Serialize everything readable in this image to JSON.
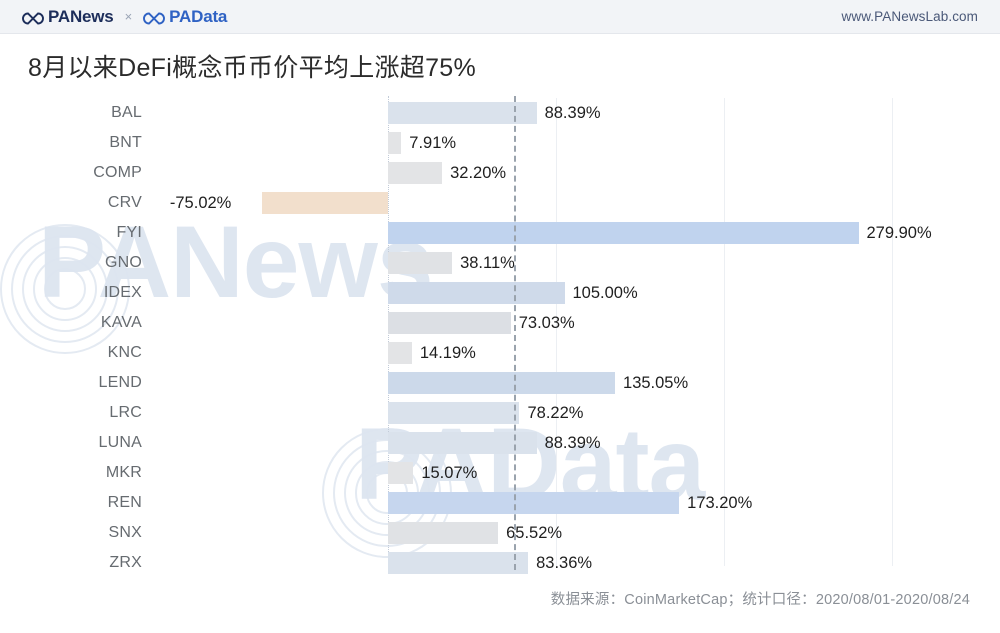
{
  "header": {
    "brand_primary": "PANews",
    "brand_separator": "×",
    "brand_secondary": "PAData",
    "site_url": "www.PANewsLab.com",
    "logo_icon": "infinity-icon"
  },
  "title": "8月以来DeFi概念币币价平均上涨超75%",
  "footer": {
    "source_note": "数据来源：CoinMarketCap；统计口径：2020/08/01-2020/08/24"
  },
  "watermark": {
    "text_1": "PANews",
    "text_2": "PAData"
  },
  "colors": {
    "negative_bar": "#f2dfcc",
    "bar_gray": "#e3e4e6",
    "bar_light_blue": "#dae2ec",
    "bar_mid_blue": "#ccd9ea",
    "bar_strong_blue": "#c0d3ee",
    "average_line": "#9aa3ad",
    "zero_line": "#c2cbd8",
    "grid": "#eceff3",
    "label_text": "#666b70",
    "value_text": "#1f1f1f",
    "header_bg": "#f2f4f7",
    "brand_navy": "#1c2d5a",
    "brand_blue": "#2f62c4"
  },
  "chart_data": {
    "type": "bar",
    "orientation": "horizontal",
    "title": "8月以来DeFi概念币币价平均上涨超75%",
    "xlabel": "",
    "ylabel": "",
    "grid": true,
    "legend": "none",
    "xlim": [
      -100,
      360
    ],
    "average_reference": 75,
    "value_suffix": "%",
    "categories": [
      "BAL",
      "BNT",
      "COMP",
      "CRV",
      "FYI",
      "GNO",
      "IDEX",
      "KAVA",
      "KNC",
      "LEND",
      "LRC",
      "LUNA",
      "MKR",
      "REN",
      "SNX",
      "ZRX"
    ],
    "values": [
      88.39,
      7.91,
      32.2,
      -75.02,
      279.9,
      38.11,
      105.0,
      73.03,
      14.19,
      135.05,
      78.22,
      88.39,
      15.07,
      173.2,
      65.52,
      83.36
    ],
    "labels": [
      "88.39%",
      "7.91%",
      "32.20%",
      "-75.02%",
      "279.90%",
      "38.11%",
      "105.00%",
      "73.03%",
      "14.19%",
      "135.05%",
      "78.22%",
      "88.39%",
      "15.07%",
      "173.20%",
      "65.52%",
      "83.36%"
    ],
    "bar_colors": [
      "#dae2ec",
      "#e3e4e6",
      "#e3e4e6",
      "#f2dfcc",
      "#c0d3ee",
      "#e0e2e5",
      "#cfdaea",
      "#dcdfe4",
      "#e3e4e6",
      "#ccd9ea",
      "#dae2ec",
      "#dae2ec",
      "#e3e4e6",
      "#c6d6ee",
      "#e0e2e5",
      "#dae2ec"
    ],
    "gridline_values": [
      0,
      100,
      200,
      300
    ]
  }
}
